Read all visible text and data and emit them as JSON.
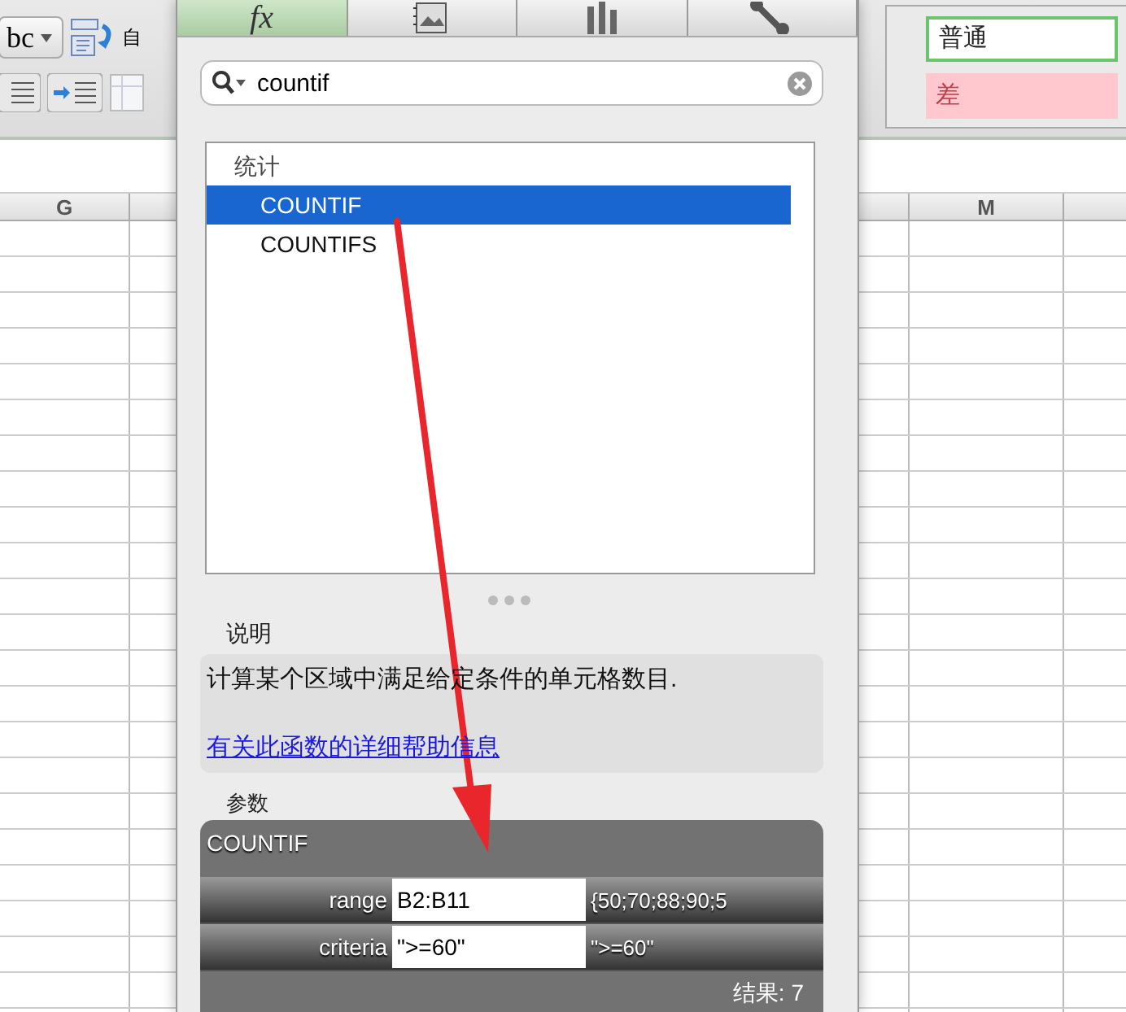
{
  "toolbar": {
    "font_button": "bc",
    "wrap_label": "自"
  },
  "styles": [
    {
      "label": "普通",
      "kind": "normal"
    },
    {
      "label": "差",
      "kind": "bad"
    }
  ],
  "sheet": {
    "left_columns": [
      "G"
    ],
    "right_columns": [
      "M"
    ]
  },
  "builder": {
    "tabs": [
      {
        "kind": "formula",
        "label": "fx",
        "selected": true
      },
      {
        "kind": "media",
        "selected": false
      },
      {
        "kind": "chart",
        "selected": false
      },
      {
        "kind": "tools",
        "selected": false
      }
    ],
    "search": {
      "value": "countif"
    },
    "function_list": {
      "category": "统计",
      "items": [
        {
          "label": "COUNTIF",
          "selected": true
        },
        {
          "label": "COUNTIFS",
          "selected": false
        }
      ]
    },
    "description": {
      "heading": "说明",
      "text": "计算某个区域中满足给定条件的单元格数目.",
      "link": "有关此函数的详细帮助信息"
    },
    "arguments": {
      "heading": "参数",
      "function": "COUNTIF",
      "rows": [
        {
          "name": "range",
          "value": "B2:B11",
          "result": "{50;70;88;90;5"
        },
        {
          "name": "criteria",
          "value": "\">=60\"",
          "result": "\">=60\""
        }
      ],
      "result": "结果: 7"
    }
  }
}
